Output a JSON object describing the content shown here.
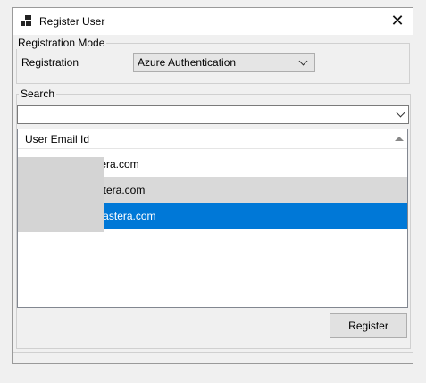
{
  "window": {
    "title": "Register User"
  },
  "registration_mode": {
    "group_label": "Registration Mode",
    "field_label": "Registration",
    "selected": "Azure Authentication"
  },
  "search": {
    "group_label": "Search",
    "value": ""
  },
  "list": {
    "column_header": "User Email Id",
    "rows": [
      {
        "email": "stera.com",
        "state": "normal"
      },
      {
        "email": "astera.com",
        "state": "hover"
      },
      {
        "email": "@astera.com",
        "state": "selected"
      }
    ]
  },
  "buttons": {
    "register": "Register"
  },
  "icons": {
    "window": "app-window-icon",
    "close": "close-icon",
    "dropdown": "chevron-down-icon",
    "sort": "sort-ascending-icon"
  },
  "colors": {
    "selection": "#0078d7",
    "hover": "#d9d9d9"
  }
}
